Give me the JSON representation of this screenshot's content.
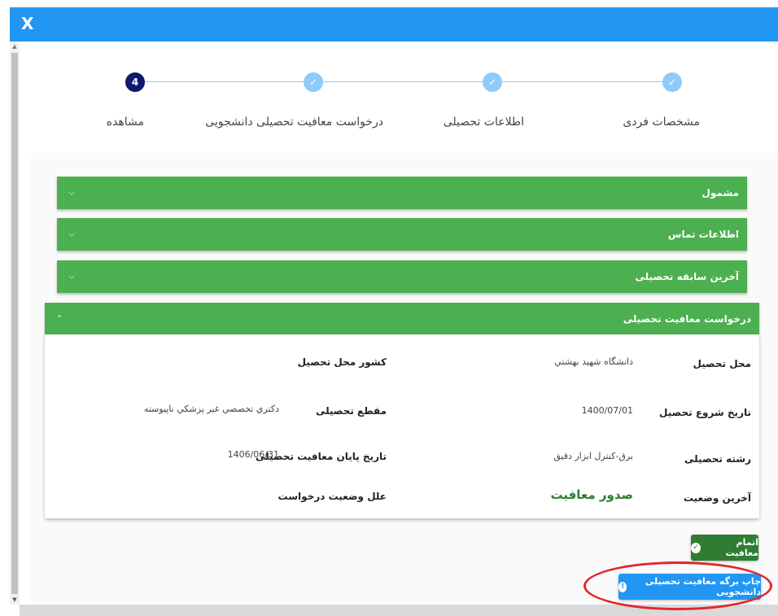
{
  "window": {
    "close_label": "X",
    "colors": {
      "titlebar": "#2196f3"
    }
  },
  "stepper": {
    "steps": [
      {
        "label": "مشخصات فردی",
        "state": "done",
        "icon": "check-icon"
      },
      {
        "label": "اطلاعات تحصیلی",
        "state": "done",
        "icon": "check-icon"
      },
      {
        "label": "درخواست معافیت تحصیلی دانشجویی",
        "state": "done",
        "icon": "check-icon"
      },
      {
        "label": "مشاهده",
        "state": "active",
        "number": "4"
      }
    ]
  },
  "accordion": {
    "sections": [
      {
        "title": "مشمول",
        "expanded": false
      },
      {
        "title": "اطلاعات تماس",
        "expanded": false
      },
      {
        "title": "آخرین سابقه تحصیلی",
        "expanded": false
      },
      {
        "title": "درخواست معافیت تحصیلی",
        "expanded": true
      }
    ],
    "colors": {
      "header": "#4caf50"
    }
  },
  "details": {
    "place_label": "محل تحصیل",
    "place_value": "دانشگاه شهيد بهشتي",
    "country_label": "کشور محل تحصیل",
    "country_value": "",
    "start_date_label": "تاریخ شروع تحصیل",
    "start_date_value": "1400/07/01",
    "level_label": "مقطع تحصیلی",
    "level_value": "دكتري تخصصي غير پزشكي ناپيوسته",
    "field_label": "رشته تحصیلی",
    "field_value": "برق-كنترل ابزار دقيق",
    "end_date_label": "تاریخ پایان معافیت تحصیلی",
    "end_date_value": "1406/06/31",
    "status_label": "آخرین وضعیت",
    "status_value": "صدور معافیت",
    "reasons_label": "علل وضعیت درخواست",
    "reasons_value": ""
  },
  "actions": {
    "finish_label": "اتمام معافیت",
    "print_label": "چاپ برگه معافیت تحصیلی دانشجویی",
    "colors": {
      "finish": "#2e7d32",
      "print": "#2196f3",
      "highlight": "#e0282c"
    }
  }
}
